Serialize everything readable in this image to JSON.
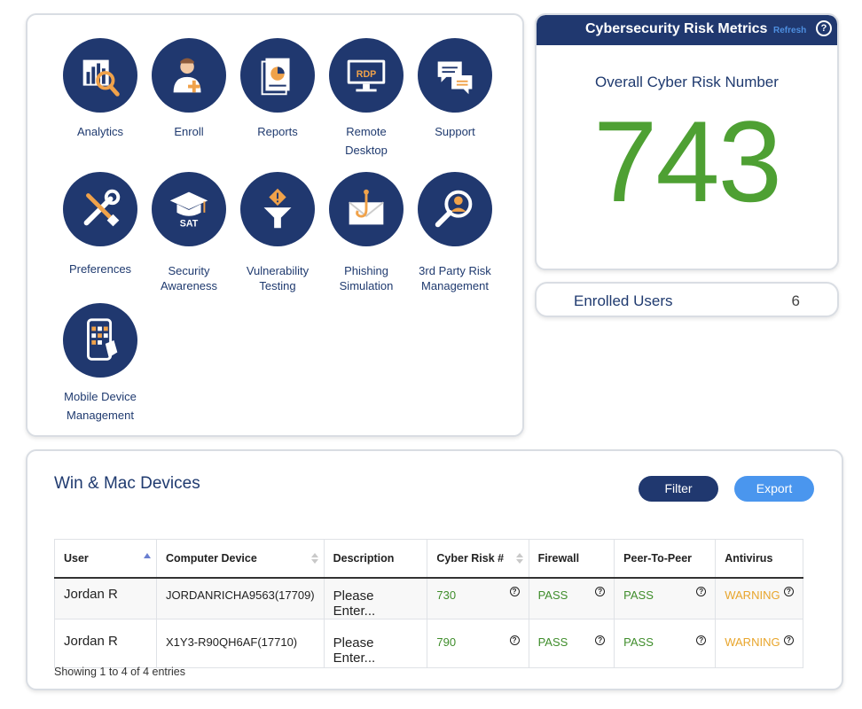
{
  "apps": [
    {
      "label": "Analytics",
      "icon": "analytics-icon"
    },
    {
      "label": "Enroll",
      "icon": "enroll-icon"
    },
    {
      "label": "Reports",
      "icon": "reports-icon"
    },
    {
      "label": "Remote Desktop",
      "line1": "Remote",
      "line2": "Desktop",
      "icon": "remote-desktop-icon",
      "badge": "RDP"
    },
    {
      "label": "Support",
      "icon": "support-icon"
    },
    {
      "label": "Preferences",
      "icon": "preferences-icon"
    },
    {
      "label": "Security Awareness",
      "line1": "Security",
      "line2": "Awareness",
      "icon": "security-awareness-icon",
      "badge": "SAT"
    },
    {
      "label": "Vulnerability Testing",
      "line1": "Vulnerability",
      "line2": "Testing",
      "icon": "vulnerability-icon"
    },
    {
      "label": "Phishing Simulation",
      "line1": "Phishing",
      "line2": "Simulation",
      "icon": "phishing-icon"
    },
    {
      "label": "3rd Party Risk Management",
      "line1": "3rd Party Risk",
      "line2": "Management",
      "icon": "third-party-risk-icon"
    },
    {
      "label": "Mobile Device Management",
      "line1": "Mobile Device",
      "line2": "Management",
      "icon": "mobile-device-icon"
    }
  ],
  "risk": {
    "title": "Cybersecurity Risk Metrics",
    "refresh": "Refresh",
    "help": "?",
    "subtitle": "Overall Cyber Risk Number",
    "value": "743"
  },
  "enrolled": {
    "label": "Enrolled Users",
    "value": "6"
  },
  "devices": {
    "title": "Win & Mac Devices",
    "filter": "Filter",
    "export": "Export",
    "columns": [
      "User",
      "Computer Device",
      "Description",
      "Cyber Risk #",
      "Firewall",
      "Peer-To-Peer",
      "Antivirus"
    ],
    "rows": [
      {
        "user": "Jordan R",
        "device": "JORDANRICHA9563(17709)",
        "description": "Please Enter...",
        "risk": "730",
        "firewall": "PASS",
        "p2p": "PASS",
        "antivirus": "WARNING"
      },
      {
        "user": "Jordan R",
        "device": "X1Y3-R90QH6AF(17710)",
        "description": "Please Enter...",
        "risk": "790",
        "firewall": "PASS",
        "p2p": "PASS",
        "antivirus": "WARNING"
      }
    ],
    "footer": "Showing 1 to 4 of 4 entries"
  },
  "colors": {
    "navy": "#20386f",
    "green": "#4ea033",
    "warning": "#e8a52b",
    "accent": "#4a96ee"
  }
}
